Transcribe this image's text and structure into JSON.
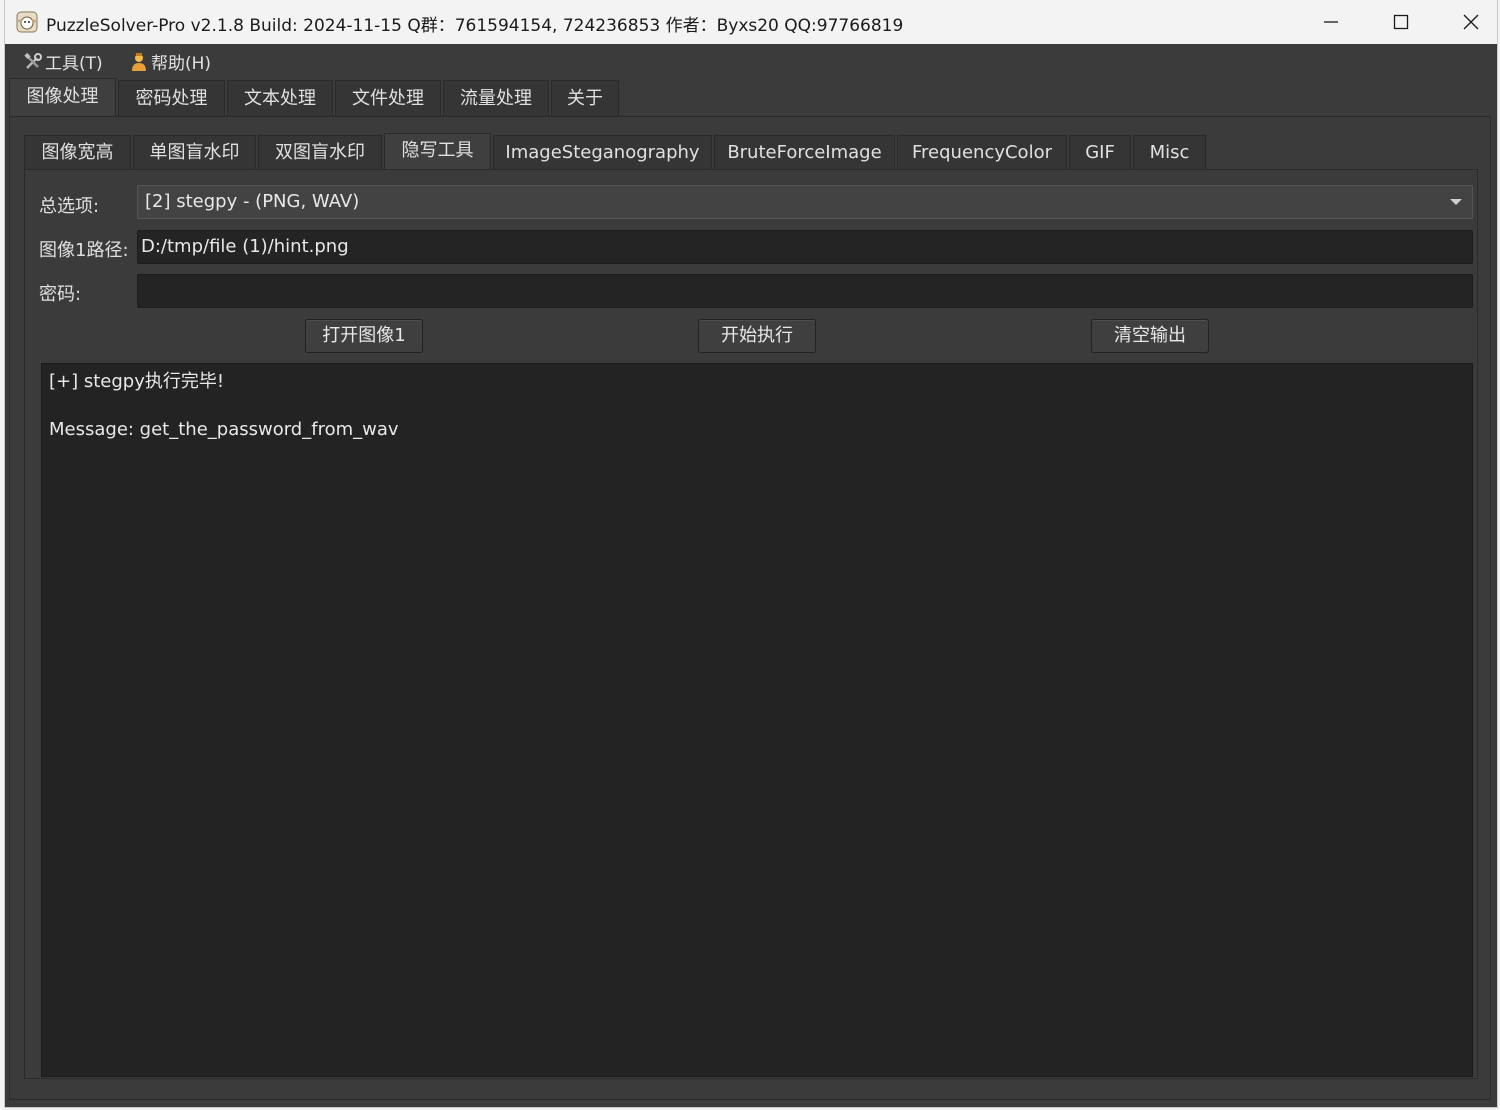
{
  "window": {
    "title": "PuzzleSolver-Pro v2.1.8  Build: 2024-11-15  Q群：761594154, 724236853  作者：Byxs20  QQ:97766819"
  },
  "menu": {
    "tools": "工具(T)",
    "help": "帮助(H)"
  },
  "top_tabs": [
    "图像处理",
    "密码处理",
    "文本处理",
    "文件处理",
    "流量处理",
    "关于"
  ],
  "top_tab_active": "图像处理",
  "sub_tabs": [
    "图像宽高",
    "单图盲水印",
    "双图盲水印",
    "隐写工具",
    "ImageSteganography",
    "BruteForceImage",
    "FrequencyColor",
    "GIF",
    "Misc"
  ],
  "sub_tab_active": "隐写工具",
  "form": {
    "option_label": "总选项:",
    "option_value": "[2] stegpy - (PNG, WAV)",
    "image1_label": "图像1路径:",
    "image1_value": "D:/tmp/file (1)/hint.png",
    "password_label": "密码:",
    "password_value": ""
  },
  "buttons": {
    "open_image": "打开图像1",
    "start": "开始执行",
    "clear": "清空输出"
  },
  "output": {
    "line1": "[+] stegpy执行完毕!",
    "line2": "Message: get_the_password_from_wav"
  }
}
